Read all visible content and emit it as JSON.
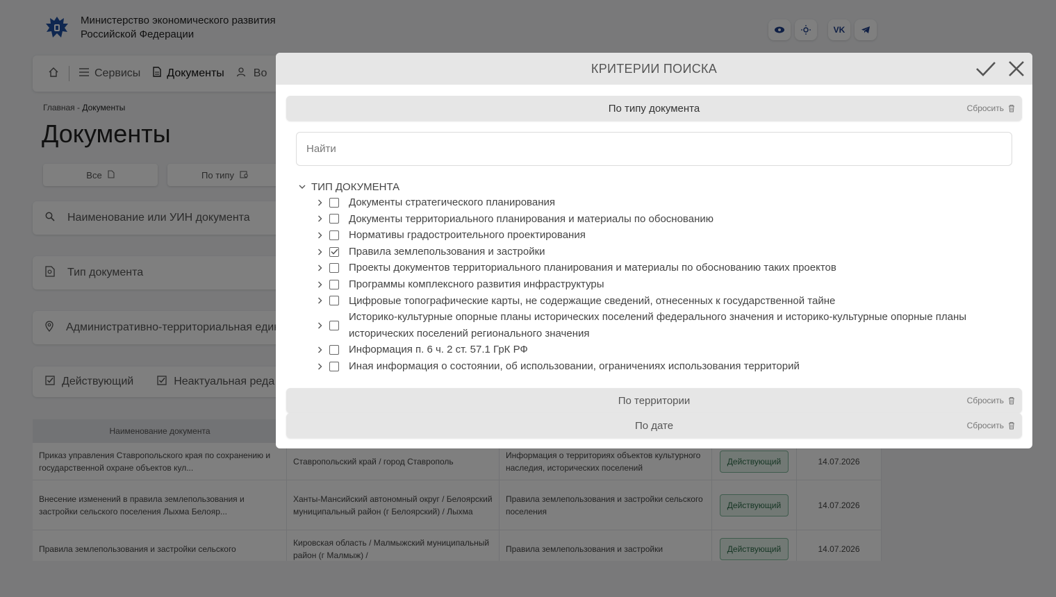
{
  "header": {
    "ministry_line1": "Министерство экономического развития",
    "ministry_line2": "Российской Федерации",
    "icons": [
      "eye-icon",
      "sun-icon",
      "vk-icon",
      "telegram-icon"
    ]
  },
  "nav": {
    "services": "Сервисы",
    "documents": "Документы",
    "partial": "Во"
  },
  "breadcrumb": {
    "home": "Главная",
    "sep": " - ",
    "current": "Документы"
  },
  "page_title": "Документы",
  "filter_buttons": {
    "all": "Все",
    "by_type": "По типу"
  },
  "fields": {
    "name": "Наименование или УИН документа",
    "type": "Тип документа",
    "territory": "Административно-территориальная един"
  },
  "status_chips": {
    "active": "Действующий",
    "outdated": "Неактуальная реда"
  },
  "table": {
    "header_name": "Наименование документа",
    "rows": [
      {
        "name": "Приказ управления Ставропольского края по сохранению и государственной охране объектов кул...",
        "territory": "Ставропольский край / город Ставрополь",
        "type": "Информация о территориях объектов культурного наследия, исторических поселений",
        "status": "Действующий",
        "date": "14.07.2026"
      },
      {
        "name": "Внесение изменений в правила землепользования и застройки сельского поселения Лыхма Белояр...",
        "territory": "Ханты-Мансийский автономный округ / Белоярский муниципальный район (г Белоярский) / Лыхма",
        "type": "Правила землепользования и застройки сельского поселения",
        "status": "Действующий",
        "date": "14.07.2026"
      },
      {
        "name": "Правила землепользования и застройки сельского",
        "territory": "Кировская область / Малмыжский муниципальный район (г Малмыж) /",
        "type": "Правила землепользования и застройки",
        "status": "Действующий",
        "date": "14.07.2026"
      }
    ]
  },
  "modal": {
    "title": "КРИТЕРИИ ПОИСКА",
    "reset_label": "Сбросить",
    "section_type": "По типу документа",
    "section_territory": "По территории",
    "section_date": "По дате",
    "search_placeholder": "Найти",
    "tree_root": "ТИП ДОКУМЕНТА",
    "tree_items": [
      {
        "label": "Документы стратегического планирования",
        "checked": false
      },
      {
        "label": "Документы территориального планирования и материалы по обоснованию",
        "checked": false
      },
      {
        "label": "Нормативы градостроительного проектирования",
        "checked": false
      },
      {
        "label": "Правила землепользования и застройки",
        "checked": true
      },
      {
        "label": "Проекты документов территориального планирования и материалы по обоснованию таких проектов",
        "checked": false
      },
      {
        "label": "Программы комплексного развития инфраструктуры",
        "checked": false
      },
      {
        "label": "Цифровые топографические карты, не содержащие сведений, отнесенных к государственной тайне",
        "checked": false
      },
      {
        "label": "Историко-культурные опорные планы исторических поселений федерального значения и историко-культурные опорные планы исторических поселений регионального значения",
        "checked": false
      },
      {
        "label": "Информация п. 6 ч. 2 ст. 57.1 ГрК РФ",
        "checked": false
      },
      {
        "label": "Иная информация о состоянии, об использовании, ограничениях использования территорий",
        "checked": false
      }
    ]
  }
}
